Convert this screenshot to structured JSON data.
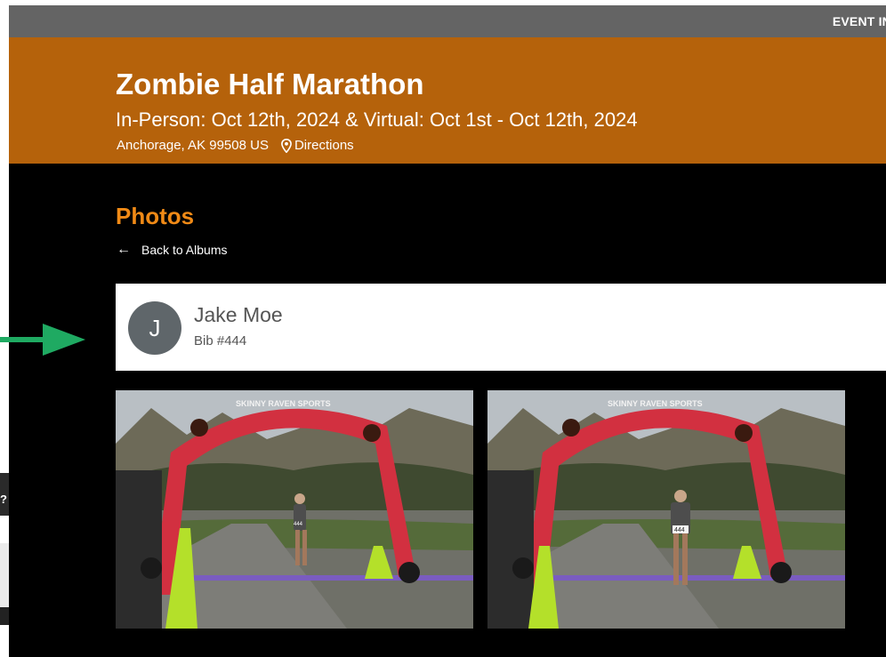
{
  "header": {
    "event_info_label": "EVENT IN"
  },
  "event": {
    "title": "Zombie Half Marathon",
    "dates": "In-Person: Oct 12th, 2024 & Virtual: Oct 1st - Oct 12th, 2024",
    "location": "Anchorage, AK 99508 US",
    "directions_label": "Directions"
  },
  "photos": {
    "title": "Photos",
    "back_label": "Back to Albums"
  },
  "runner": {
    "initial": "J",
    "name": "Jake Moe",
    "bib": "Bib #444"
  },
  "gallery": {
    "photo_1": {
      "arch_text": "SKINNY RAVEN SPORTS",
      "runner_bib": "444"
    },
    "photo_2": {
      "arch_text": "SKINNY RAVEN SPORTS",
      "runner_bib": "444"
    }
  },
  "side_widget": {
    "question_mark": "?"
  },
  "colors": {
    "hero_bg": "#b5620b",
    "accent_orange": "#f08a16",
    "annotation_arrow": "#1faa62",
    "avatar_bg": "#5f666a"
  }
}
